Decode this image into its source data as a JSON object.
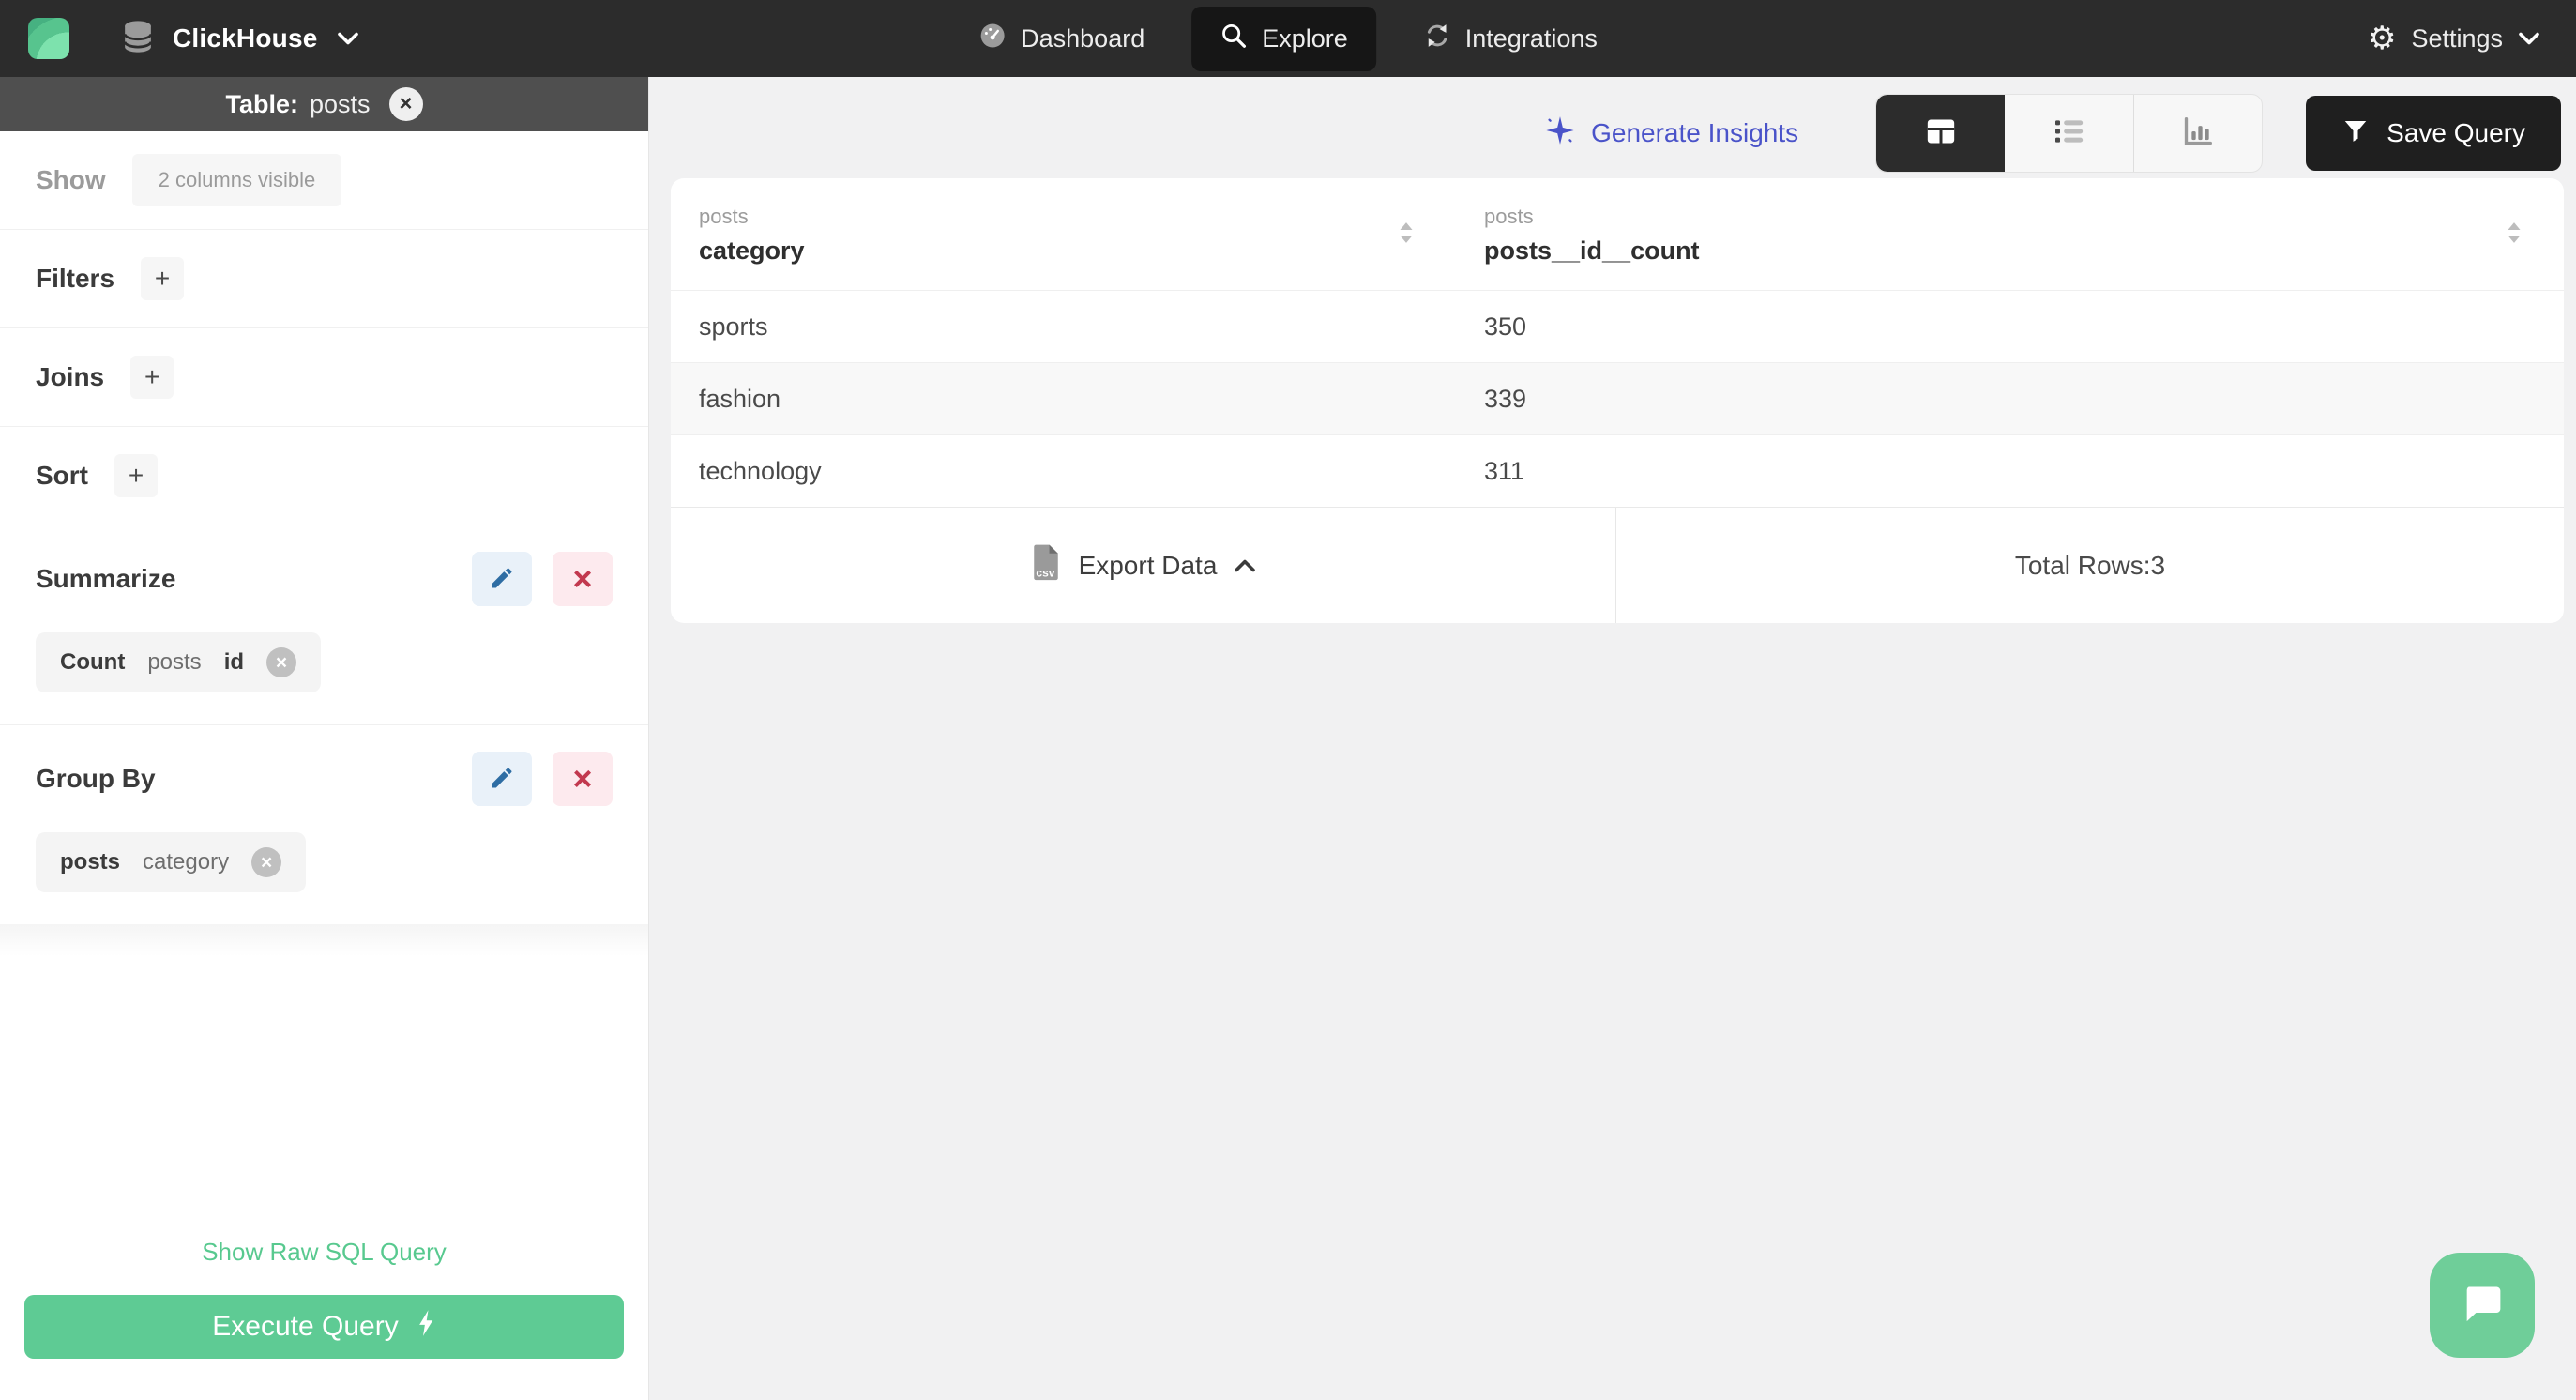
{
  "navbar": {
    "brand": "ClickHouse",
    "nav": [
      {
        "label": "Dashboard"
      },
      {
        "label": "Explore",
        "active": true
      },
      {
        "label": "Integrations"
      }
    ],
    "settings_label": "Settings"
  },
  "sidebar": {
    "table_bar": {
      "label": "Table:",
      "name": "posts"
    },
    "show_label": "Show",
    "show_button": "2 columns visible",
    "filters_label": "Filters",
    "joins_label": "Joins",
    "sort_label": "Sort",
    "summarize_label": "Summarize",
    "summarize_chip": {
      "fn": "Count",
      "table": "posts",
      "column": "id"
    },
    "group_by_label": "Group By",
    "group_by_chip": {
      "table": "posts",
      "column": "category"
    },
    "raw_sql_link": "Show Raw SQL Query",
    "execute_label": "Execute Query"
  },
  "toolbar": {
    "insights_label": "Generate Insights",
    "save_label": "Save Query"
  },
  "results": {
    "columns": [
      {
        "table": "posts",
        "name": "category"
      },
      {
        "table": "posts",
        "name": "posts__id__count"
      }
    ],
    "rows": [
      {
        "category": "sports",
        "count": "350"
      },
      {
        "category": "fashion",
        "count": "339"
      },
      {
        "category": "technology",
        "count": "311"
      }
    ],
    "export_label": "Export Data",
    "total_label": "Total Rows:3",
    "csv_badge": "csv"
  },
  "icons": {
    "gear": "⚙",
    "close": "×",
    "plus": "+",
    "remove": "×",
    "delete": "×"
  },
  "colors": {
    "accent_green": "#5ECB94",
    "navbar_dark": "#2C2C2C",
    "table_bar_gray": "#4F4F4F",
    "insights_indigo": "#4A53C9",
    "edit_blue": "#2E6DA4",
    "delete_red": "#C2394F",
    "main_bg": "#F1F1F2"
  }
}
